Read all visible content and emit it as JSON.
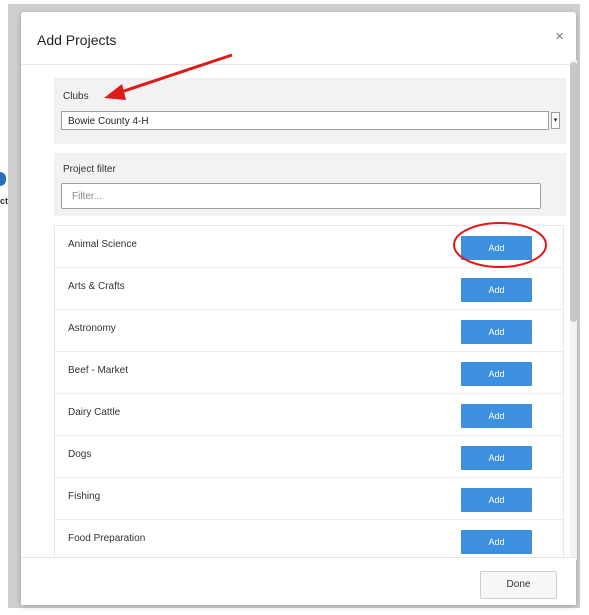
{
  "background": {
    "fragment_text": "ct"
  },
  "dialog": {
    "title": "Add Projects",
    "close_glyph": "×",
    "clubs": {
      "label": "Clubs",
      "selected": "Bowie County 4-H",
      "arrow_glyph": "▾"
    },
    "project_filter": {
      "label": "Project filter",
      "placeholder": "Filter..."
    },
    "projects": [
      {
        "name": "Animal Science",
        "action": "Add"
      },
      {
        "name": "Arts & Crafts",
        "action": "Add"
      },
      {
        "name": "Astronomy",
        "action": "Add"
      },
      {
        "name": "Beef - Market",
        "action": "Add"
      },
      {
        "name": "Dairy Cattle",
        "action": "Add"
      },
      {
        "name": "Dogs",
        "action": "Add"
      },
      {
        "name": "Fishing",
        "action": "Add"
      },
      {
        "name": "Food Preparation",
        "action": "Add"
      }
    ],
    "done_label": "Done"
  },
  "colors": {
    "add_button": "#3d8fe0",
    "annotation_red": "#e01a1a",
    "section_bg": "#f2f2f2"
  }
}
